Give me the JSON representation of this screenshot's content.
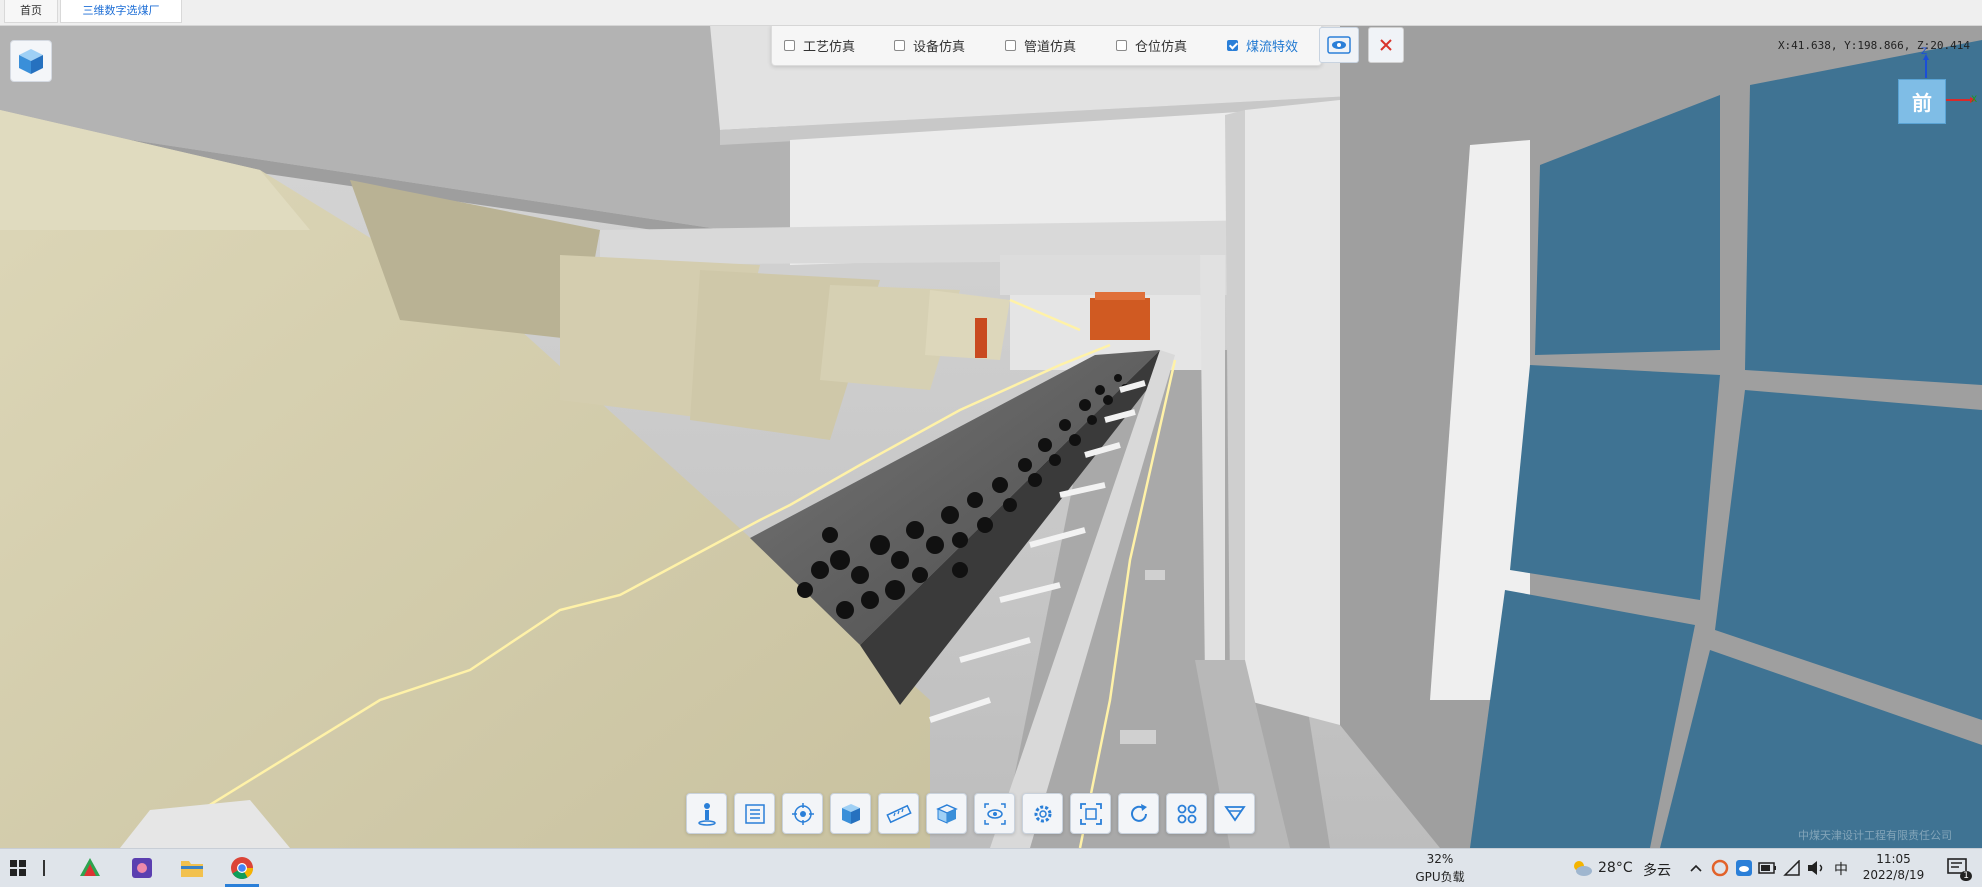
{
  "tabs": [
    {
      "label": "首页",
      "active": false
    },
    {
      "label": "三维数字选煤厂",
      "active": true
    }
  ],
  "sim_toolbar": {
    "items": [
      {
        "label": "工艺仿真",
        "checked": false
      },
      {
        "label": "设备仿真",
        "checked": false
      },
      {
        "label": "管道仿真",
        "checked": false
      },
      {
        "label": "仓位仿真",
        "checked": false
      },
      {
        "label": "煤流特效",
        "checked": true
      }
    ]
  },
  "coords": "X:41.638, Y:198.866, Z:20.414",
  "view_cube": {
    "face": "前",
    "axis_z": "Z",
    "axis_x": "X"
  },
  "watermark": "中煤天津设计工程有限责任公司",
  "bottom_tools": [
    "walk-icon",
    "list-icon",
    "target-icon",
    "box-icon",
    "ruler-icon",
    "section-box-icon",
    "eye-view-icon",
    "settings-icon",
    "frame-icon",
    "refresh-icon",
    "command-icon",
    "layers-icon"
  ],
  "taskbar": {
    "gpu_percent": "32%",
    "gpu_label": "GPU负载",
    "temperature": "28°C",
    "weather": "多云",
    "ime": "中",
    "time": "11:05",
    "date": "2022/8/19",
    "notification_count": "1"
  },
  "colors": {
    "accent": "#2a7fd8",
    "close": "#d9342b",
    "belt_frame": "#f3e6b4",
    "window_glass": "#3f7393"
  }
}
